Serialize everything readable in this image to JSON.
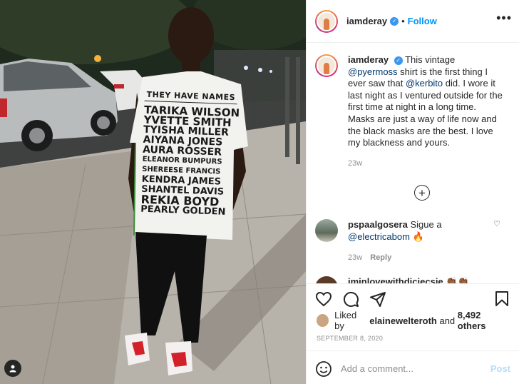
{
  "post": {
    "username": "iamderay",
    "follow_label": "Follow",
    "separator": "•",
    "more_label": "•••"
  },
  "caption": {
    "username": "iamderay",
    "text_1": "This vintage ",
    "mention_1": "@pyermoss",
    "text_2": " shirt is the first thing I ever saw that ",
    "mention_2": "@kerbito",
    "text_3": " did. I wore it last night as I ventured outside for the first time at night in a long time. Masks are just a way of life now and the black masks are the best. I love my blackness and yours.",
    "time": "23w"
  },
  "load_more_label": "+",
  "comments": [
    {
      "username": "pspaalgosera",
      "text": "Sigue a",
      "mention": "@electricabom",
      "emoji": "🔥",
      "time": "23w",
      "reply_label": "Reply"
    },
    {
      "username": "iminlovewithdiciecsie",
      "emoji": "👏🏾👏🏾"
    }
  ],
  "likes": {
    "prefix": "Liked by ",
    "user": "elainewelteroth",
    "and": " and ",
    "count": "8,492 others"
  },
  "date": "SEPTEMBER 8, 2020",
  "add_comment": {
    "placeholder": "Add a comment...",
    "post_label": "Post"
  },
  "shirt": {
    "header": "THEY HAVE NAMES",
    "names": [
      "TARIKA WILSON",
      "YVETTE SMITH",
      "TYISHA MILLER",
      "AIYANA JONES",
      "AURA ROSSER",
      "ELEANOR BUMPURS",
      "SHEREESE FRANCIS",
      "KENDRA JAMES",
      "SHANTEL DAVIS",
      "REKIA BOYD",
      "PEARLY GOLDEN"
    ]
  },
  "icons": {
    "like": "heart-icon",
    "comment": "comment-icon",
    "share": "send-icon",
    "save": "bookmark-icon",
    "emoji": "smiley-icon",
    "tag": "user-tag-icon"
  },
  "colors": {
    "accent": "#0095f6",
    "verified": "#3897f0",
    "muted": "#8e8e8e"
  }
}
